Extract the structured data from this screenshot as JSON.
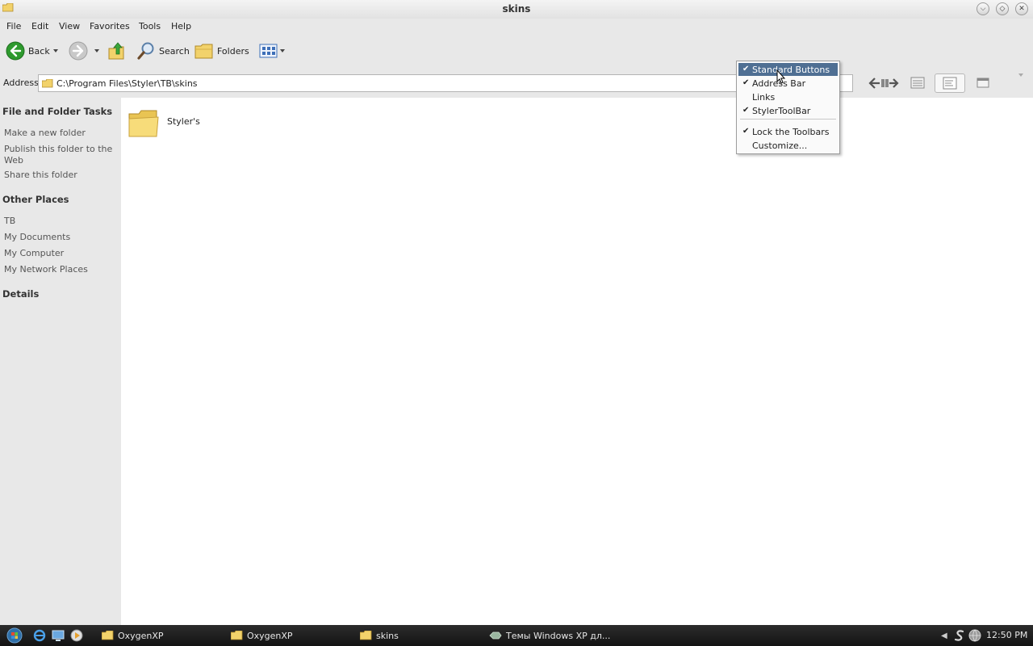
{
  "window": {
    "title": "skins"
  },
  "menu": [
    "File",
    "Edit",
    "View",
    "Favorites",
    "Tools",
    "Help"
  ],
  "toolbar": {
    "back_label": "Back",
    "search_label": "Search",
    "folders_label": "Folders"
  },
  "address": {
    "label": "Address",
    "value": "C:\\Program Files\\Styler\\TB\\skins"
  },
  "sidebar": {
    "tasks_title": "File and Folder Tasks",
    "tasks": [
      "Make a new folder",
      "Publish this folder to the Web",
      "Share this folder"
    ],
    "places_title": "Other Places",
    "places": [
      "TB",
      "My Documents",
      "My Computer",
      "My Network Places"
    ],
    "details_title": "Details"
  },
  "content": {
    "items": [
      {
        "name": "Styler's",
        "icon": "folder-icon"
      }
    ]
  },
  "context_menu": {
    "items": [
      {
        "label": "Standard Buttons",
        "checked": true,
        "highlighted": true
      },
      {
        "label": "Address Bar",
        "checked": true
      },
      {
        "label": "Links",
        "checked": false
      },
      {
        "label": "StylerToolBar",
        "checked": true
      },
      {
        "label": "Lock the Toolbars",
        "checked": true
      },
      {
        "label": "Customize...",
        "checked": false
      }
    ]
  },
  "taskbar": {
    "buttons": [
      "OxygenXP",
      "OxygenXP",
      "skins",
      "Темы Windows XP дл..."
    ],
    "time": "12:50 PM"
  },
  "colors": {
    "menu_highlight": "#4f6f93",
    "back_button": "#2e9a2e",
    "taskbar": "#1e1e1e"
  }
}
